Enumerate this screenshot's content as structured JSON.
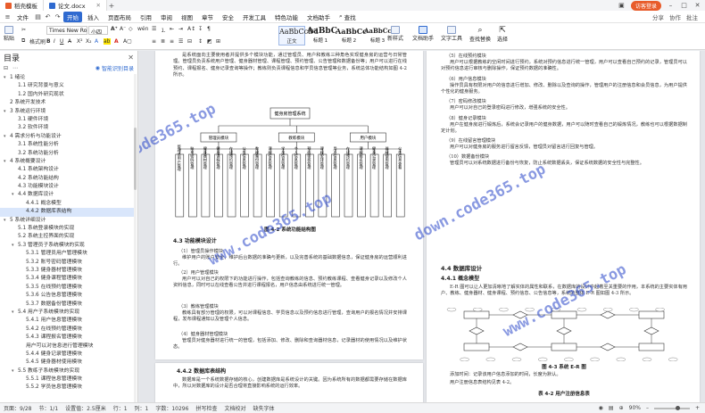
{
  "titlebar": {
    "app_tab": "稻壳模板",
    "doc_tab": "论文.docx",
    "login": "访客登录",
    "colors": {
      "app_icon": "#e85c2b",
      "doc_icon": "#2f6ad0"
    }
  },
  "menubar": {
    "items": [
      "文件",
      "开始",
      "插入",
      "页面布局",
      "引用",
      "审阅",
      "视图",
      "章节",
      "安全",
      "开发工具",
      "特色功能",
      "文档助手"
    ],
    "active": "开始",
    "search_label": "查找",
    "right": [
      "分享",
      "协作",
      "批注"
    ]
  },
  "ribbon": {
    "format_painter": "格式刷",
    "paste": "粘贴",
    "font_name": "Times New Roma",
    "font_size": "小四",
    "styles": [
      {
        "sample": "AaBbCcDd",
        "label": "正文"
      },
      {
        "sample": "AaBbC",
        "label": "标题 1"
      },
      {
        "sample": "AaBbCc",
        "label": "标题 2"
      },
      {
        "sample": "AaBbCcI",
        "label": "标题 3"
      }
    ],
    "new_style": "新样式",
    "doc_assistant": "文档助手",
    "text_tools": "文字工具",
    "find_replace": "查找替换",
    "select": "选择"
  },
  "sidebar": {
    "title": "目录",
    "smart_toc": "智能识别目录",
    "items": [
      {
        "label": "1 绪论",
        "level": 0,
        "caret": "▾"
      },
      {
        "label": "1.1 研究背景与意义",
        "level": 1
      },
      {
        "label": "1.2 国内外研究现状",
        "level": 1
      },
      {
        "label": "2 系统开发技术",
        "level": 0
      },
      {
        "label": "3 系统运行环境",
        "level": 0,
        "caret": "▾"
      },
      {
        "label": "3.1 硬件环境",
        "level": 1
      },
      {
        "label": "3.2 软件环境",
        "level": 1
      },
      {
        "label": "4 需求分析与功能设计",
        "level": 0,
        "caret": "▾"
      },
      {
        "label": "3.1 系统性能分析",
        "level": 1
      },
      {
        "label": "3.2 系统功能分析",
        "level": 1
      },
      {
        "label": "4 系统概要设计",
        "level": 0,
        "caret": "▾"
      },
      {
        "label": "4.1 系统架构设计",
        "level": 1
      },
      {
        "label": "4.2 系统功能结构",
        "level": 1
      },
      {
        "label": "4.3 功能模块设计",
        "level": 1
      },
      {
        "label": "4.4 数据库设计",
        "level": 1,
        "caret": "▾"
      },
      {
        "label": "4.4.1 概念模型",
        "level": 2
      },
      {
        "label": "4.4.2 数据库表结构",
        "level": 2,
        "selected": true
      },
      {
        "label": "5 系统详细设计",
        "level": 0,
        "caret": "▾"
      },
      {
        "label": "5.1 系统登录模块的实现",
        "level": 1
      },
      {
        "label": "5.2 系统主控界面的实现",
        "level": 1
      },
      {
        "label": "5.3 管理员子系统模块的实现",
        "level": 1,
        "caret": "▾"
      },
      {
        "label": "5.3.1 管理员用户管理模块",
        "level": 2
      },
      {
        "label": "5.3.2 账号密码管理模块",
        "level": 2
      },
      {
        "label": "5.3.3 健身器材管理模块",
        "level": 2
      },
      {
        "label": "5.3.4 健身课程管理模块",
        "level": 2
      },
      {
        "label": "5.3.5 在线预约管理模块",
        "level": 2
      },
      {
        "label": "5.3.6 公告信息管理模块",
        "level": 2
      },
      {
        "label": "5.3.7 数据备份管理模块",
        "level": 2
      },
      {
        "label": "5.4 用户子系统模块的实现",
        "level": 1,
        "caret": "▾"
      },
      {
        "label": "5.4.1 用户信息管理模块",
        "level": 2
      },
      {
        "label": "5.4.2 在线预约管理模块",
        "level": 2
      },
      {
        "label": "5.4.3 课程报名管理模块",
        "level": 2
      },
      {
        "label": "用户可以对信息进行管理模块",
        "level": 2
      },
      {
        "label": "5.4.4 健身记录管理模块",
        "level": 2
      },
      {
        "label": "5.4.5 健身器材使用模块",
        "level": 2
      },
      {
        "label": "5.5 教练子系统模块的实现",
        "level": 1,
        "caret": "▾"
      },
      {
        "label": "5.5.1 课程信息管理模块",
        "level": 2
      },
      {
        "label": "5.5.2 学员信息管理模块",
        "level": 2
      }
    ]
  },
  "left_page": {
    "intro_para": "是系统面向主要使用者并提供多个模块功能，通过管理员、用户和教练三种角色实现健身房的运营与日常管理。管理员负责系统用户管理、健身器材管理、课程管理、预约管理、公告管理和数据备份等；用户可以进行在线预约、课程报名、健身记录查询等操作；教练则负责课程信息和学员信息管理等业务，系统总体功能结构如图 4-2 所示。",
    "diagram": {
      "root": "健身房管理系统",
      "branches": [
        {
          "name": "管理员模块",
          "leaves": [
            "管理员用户管理",
            "账号密码管理",
            "健身器材管理",
            "健身课程管理",
            "在线预约管理",
            "公告信息管理",
            "数据备份管理"
          ]
        },
        {
          "name": "教练模块",
          "leaves": [
            "课程信息管理",
            "学员信息管理",
            "个人信息管理",
            "预约审核管理",
            "课程安排管理"
          ]
        },
        {
          "name": "用户模块",
          "leaves": [
            "用户信息管理",
            "在线预约管理",
            "课程报名管理",
            "健身记录管理",
            "器材使用管理",
            "公告信息查看"
          ]
        }
      ]
    },
    "figure_caption": "图 4-2  系统功能结构图",
    "section": "4.3  功能模块设计",
    "item1_title": "（1）管理员操作模块",
    "item1_text": "维护用户的账户安全，维护后台数据的准确与更新，以及完善系统的基础数据信息，保证健身房的运营顺利进行。",
    "item2_title": "（2）用户管理模块",
    "item2_text": "用户可以对自己的权限下的功能进行操作，包括查询教练的信息、预约教练课程、查看健身记录以及修改个人资料信息，同时可以在线查看公告并进行课程报名，用户信息由系统进行统一管理。",
    "item3_title": "（3）教练管理模块",
    "item3_text": "教练具有部分管理的权限，可以对课程信息、学员信息以及预约信息进行管理，查询用户的报名情况并安排课程，发布课程通知以及管理个人信息。",
    "item4_title": "（4）健身器材管理模块",
    "item4_text": "管理员对健身器材进行统一的管理，包括添加、修改、删除和查询器材信息，记录器材的使用情况以及维护状态。"
  },
  "next_page": {
    "section": "4.4.2  数据库表结构",
    "text": "数据库是一个系统数据存储的核心，创建数据库是系统设计的关键。因为系统所有的数据都需要存储在数据库中，所以对数据库的设计是否合理将直接影响系统的运行效率。"
  },
  "right_page": {
    "top_items": [
      {
        "title": "（5）在线预约模块",
        "text": "用户可以根据教练的空闲时间进行预约，系统对预约信息进行统一管理，用户可以查看自己预约的记录，管理员可以对预约信息进行审核与删除操作，保证预约数据的准确性。"
      },
      {
        "title": "（6）用户信息模块",
        "text": "操作员具有权限对用户的信息进行增加、修改、删除以及查询的操作，管理用户的注册信息和会员信息，为用户提供个性化的健身服务。"
      },
      {
        "title": "（7）密码修改模块",
        "text": "用户可以对自己的登录密码进行修改，增强系统的安全性。"
      },
      {
        "title": "（8）健身记录模块",
        "text": "用户在健身房进行锻炼后，系统会记录用户的健身数据，用户可以随时查看自己的锻炼情况，教练也可以根据数据制定计划。"
      },
      {
        "title": "（9）在线留言管理模块",
        "text": "用户可以对健身房的服务进行留言反馈，管理员对留言进行回复与管理。"
      },
      {
        "title": "（10）数据备份模块",
        "text": "管理员可以对系统数据进行备份与恢复，防止系统数据丢失，保证系统数据的安全性与完整性。"
      }
    ],
    "section": "4.4  数据库设计",
    "subsection": "4.4.1  概念模型",
    "er_text": "E-R 图可以让人更加清晰地了解实体的属性和联系，在数据库的设计中起着至关重要的作用，本系统的主要实体有用户、教练、健身器材、健身课程、预约信息、公告信息等，系统的整体 E-R 图如图 4-3 所示。",
    "er_caption": "图 4-3  系统 E-R 图",
    "after_text": "添加时间：记录该用户信息添加的时间，长度为默认。",
    "after_text2": "用户注册信息表结构见表 4-2。",
    "table_caption": "表 4-2  用户注册信息表"
  },
  "watermark": [
    "www.code365.top",
    "www.code365.top",
    "down.code365.top",
    "www.code365.top"
  ],
  "statusbar": {
    "page": "页面：9/28",
    "section": "节：1/1",
    "settings": "设置值：2.5厘米",
    "row": "行：1",
    "col": "列：1",
    "words": "字数：10296",
    "spell": "拼写检查",
    "proof": "文档校对",
    "missing_font": "缺失字体",
    "zoom": "90%"
  }
}
